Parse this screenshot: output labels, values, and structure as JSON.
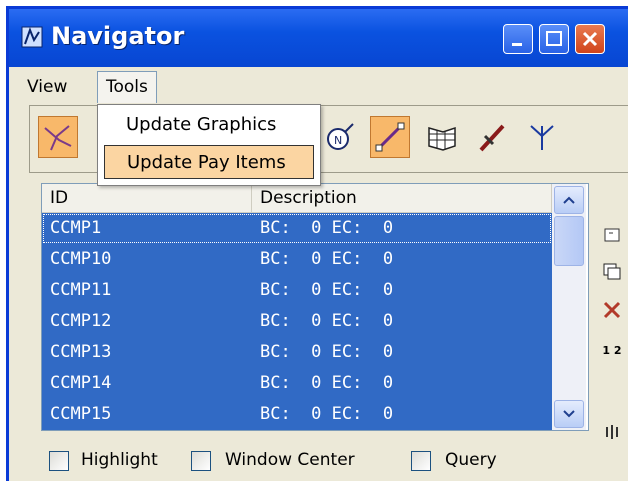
{
  "window": {
    "title": "Navigator"
  },
  "menu": {
    "view": "View",
    "tools": "Tools"
  },
  "tools_menu": {
    "items": [
      "Update Graphics",
      "Update Pay Items"
    ],
    "highlighted": "Update Pay Items"
  },
  "toolbar": {
    "icons": [
      "crossing-lines-icon",
      "compass-icon",
      "line-draw-icon",
      "flag-grid-icon",
      "pipe-icon",
      "branch-icon"
    ],
    "active": [
      "crossing-lines-icon",
      "line-draw-icon"
    ]
  },
  "list": {
    "columns": [
      "ID",
      "Description"
    ],
    "rows": [
      {
        "id": "CCMP1",
        "desc": "BC:  0 EC:  0"
      },
      {
        "id": "CCMP10",
        "desc": "BC:  0 EC:  0"
      },
      {
        "id": "CCMP11",
        "desc": "BC:  0 EC:  0"
      },
      {
        "id": "CCMP12",
        "desc": "BC:  0 EC:  0"
      },
      {
        "id": "CCMP13",
        "desc": "BC:  0 EC:  0"
      },
      {
        "id": "CCMP14",
        "desc": "BC:  0 EC:  0"
      },
      {
        "id": "CCMP15",
        "desc": "BC:  0 EC:  0"
      }
    ]
  },
  "side_tools": {
    "order_label": "1 2"
  },
  "options": {
    "highlight": "Highlight",
    "window_center": "Window Center",
    "query": "Query"
  },
  "colors": {
    "title_bar": "#0a52e0",
    "selection": "#316ac5",
    "active_tool": "#f8b86a",
    "close_button": "#d0441b"
  }
}
